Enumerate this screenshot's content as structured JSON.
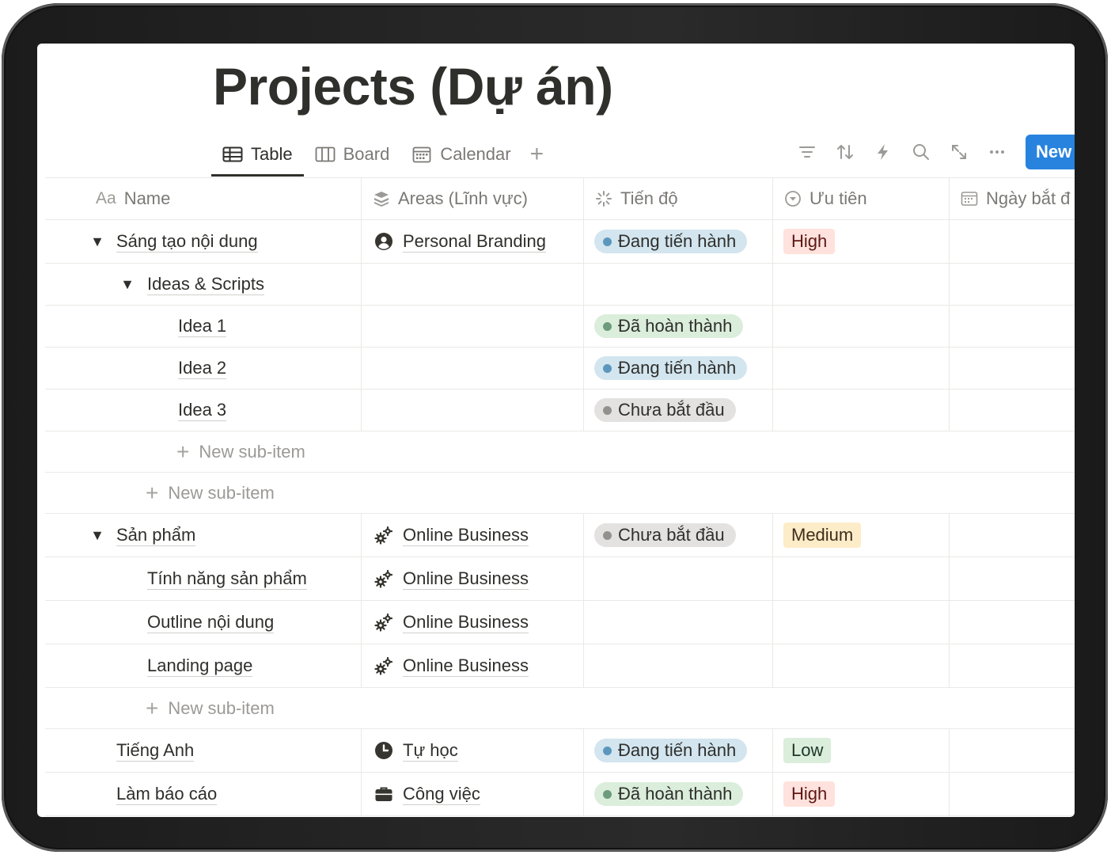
{
  "page": {
    "title": "Projects (Dự án)"
  },
  "tabs": [
    {
      "label": "Table",
      "icon": "table-icon",
      "active": true
    },
    {
      "label": "Board",
      "icon": "board-icon",
      "active": false
    },
    {
      "label": "Calendar",
      "icon": "calendar-icon",
      "active": false
    }
  ],
  "toolbar": {
    "add_view_label": "+",
    "new_label": "New",
    "icons": [
      "filter-icon",
      "sort-icon",
      "automation-bolt-icon",
      "search-icon",
      "expand-icon",
      "more-icon"
    ]
  },
  "columns": [
    {
      "prefix": "Aa",
      "label": "Name",
      "icon": "text-prefix"
    },
    {
      "label": "Areas (Lĩnh vực)",
      "icon": "relation-stack-icon"
    },
    {
      "label": "Tiến độ",
      "icon": "status-spinner-icon"
    },
    {
      "label": "Ưu tiên",
      "icon": "select-chevron-icon"
    },
    {
      "label": "Ngày bắt đ",
      "icon": "date-calendar-icon"
    }
  ],
  "rows": [
    {
      "name": "Sáng tạo nội dung",
      "area": "Personal Branding",
      "area_icon": "person-icon",
      "status": "Đang tiến hành",
      "status_color": "blue",
      "priority": "High"
    },
    {
      "name": "Ideas & Scripts"
    },
    {
      "name": "Idea 1",
      "status": "Đã hoàn thành",
      "status_color": "green"
    },
    {
      "name": "Idea 2",
      "status": "Đang tiến hành",
      "status_color": "blue"
    },
    {
      "name": "Idea 3",
      "status": "Chưa bắt đầu",
      "status_color": "gray"
    },
    {
      "name": "Sản phẩm",
      "area": "Online Business",
      "area_icon": "gears-icon",
      "status": "Chưa bắt đầu",
      "status_color": "gray",
      "priority": "Medium"
    },
    {
      "name": "Tính năng sản phẩm",
      "area": "Online Business",
      "area_icon": "gears-icon"
    },
    {
      "name": "Outline nội dung",
      "area": "Online Business",
      "area_icon": "gears-icon"
    },
    {
      "name": "Landing page",
      "area": "Online Business",
      "area_icon": "gears-icon"
    },
    {
      "name": "Tiếng Anh",
      "area": "Tự học",
      "area_icon": "clock-icon",
      "status": "Đang tiến hành",
      "status_color": "blue",
      "priority": "Low"
    },
    {
      "name": "Làm báo cáo",
      "area": "Công việc",
      "area_icon": "briefcase-icon",
      "status": "Đã hoàn thành",
      "status_color": "green",
      "priority": "High"
    }
  ],
  "new_sub_item_label": "New sub-item",
  "toggle_glyph": "▼",
  "colors": {
    "accent": "#2783de",
    "status_blue": "#d3e5ef",
    "status_green": "#dbeddb",
    "status_gray": "#e3e2e0",
    "prio_high": "#ffe2dd",
    "prio_medium": "#fdecc8",
    "prio_low": "#dbeddb"
  }
}
